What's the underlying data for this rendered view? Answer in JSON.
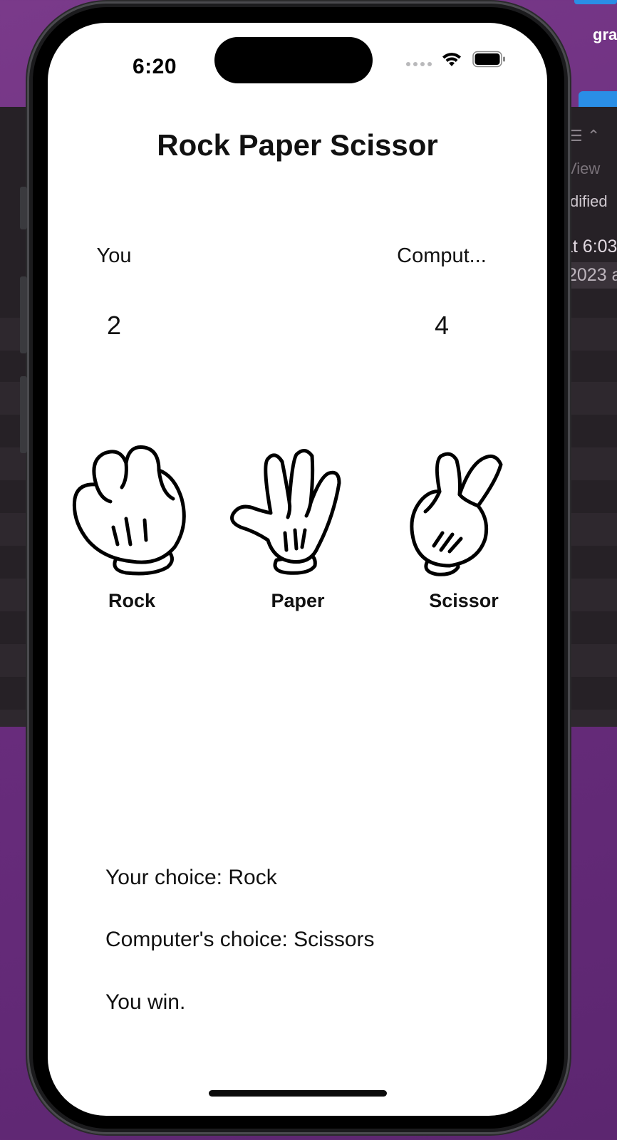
{
  "status_bar": {
    "time": "6:20",
    "icons": [
      "signal-dots-icon",
      "wifi-icon",
      "battery-icon"
    ]
  },
  "background_finder": {
    "item_name": "gra",
    "column_view": "View",
    "column_modified": "dified",
    "row1_date": "at 6:03",
    "row2_date": "2023 a"
  },
  "app": {
    "title": "Rock Paper Scissor",
    "scoreboard": {
      "player_label": "You",
      "computer_label": "Comput...",
      "player_score": "2",
      "computer_score": "4"
    },
    "choices": [
      {
        "label": "Rock",
        "icon": "rock-hand-icon"
      },
      {
        "label": "Paper",
        "icon": "paper-hand-icon"
      },
      {
        "label": "Scissor",
        "icon": "scissor-hand-icon"
      }
    ],
    "results": {
      "your_choice": "Your choice: Rock",
      "computer_choice": "Computer's choice: Scissors",
      "outcome": "You win."
    }
  },
  "colors": {
    "desktop_background": "#6a2d7e",
    "screen_background": "#ffffff",
    "text": "#111111",
    "phone_frame": "#1b1b1d"
  }
}
